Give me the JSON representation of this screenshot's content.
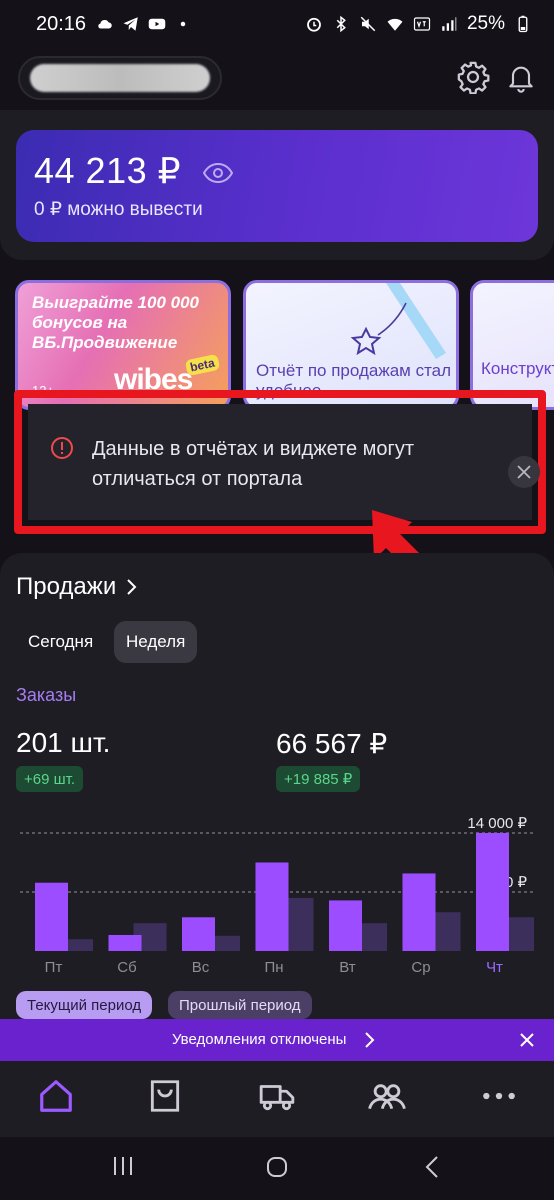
{
  "status_bar": {
    "time": "20:16",
    "battery": "25%",
    "icons_left": [
      "cloud-icon",
      "telegram-icon",
      "youtube-icon",
      "dot-icon"
    ],
    "icons_right": [
      "alarm-icon",
      "bluetooth-icon",
      "mute-icon",
      "wifi-icon",
      "volte-icon",
      "signal-icon",
      "battery-icon"
    ]
  },
  "top_bar": {
    "icons": [
      "gear-icon",
      "bell-icon"
    ]
  },
  "balance": {
    "amount": "44 213 ₽",
    "withdrawable": "0 ₽ можно вывести"
  },
  "promos": {
    "card1": {
      "title": "Выиграйте 100 000 бонусов на ВБ.Продвижение",
      "age": "12+",
      "logo": "wibes",
      "badge": "beta"
    },
    "card2": {
      "title": "Отчёт по продажам стал удобнее"
    },
    "card3": {
      "title": "Конструктор тарифов"
    }
  },
  "notice": {
    "text": "Данные в отчётах и виджете могут отличаться от портала"
  },
  "sales": {
    "title": "Продажи",
    "tabs": {
      "today": "Сегодня",
      "week": "Неделя"
    },
    "section": "Заказы",
    "count": "201 шт.",
    "count_delta": "+69 шт.",
    "sum": "66 567 ₽",
    "sum_delta": "+19 885 ₽",
    "legend": {
      "current": "Текущий период",
      "previous": "Прошлый период"
    }
  },
  "chart_data": {
    "type": "bar",
    "categories": [
      "Пт",
      "Сб",
      "Вс",
      "Пн",
      "Вт",
      "Ср",
      "Чт"
    ],
    "ylim": [
      0,
      14000
    ],
    "ticks": [
      "7 000 ₽",
      "14 000 ₽"
    ],
    "tick_values": [
      7000,
      14000
    ],
    "series": [
      {
        "name": "Текущий период",
        "values": [
          8100,
          1900,
          4000,
          10500,
          6000,
          9200,
          14000
        ]
      },
      {
        "name": "Прошлый период",
        "values": [
          1400,
          3300,
          1800,
          6300,
          3300,
          4600,
          4000
        ]
      }
    ],
    "colors": {
      "current": "#9b4dff",
      "previous": "#3d2f5c",
      "highlight_label": "#9b6bff"
    },
    "highlight_category": "Чт"
  },
  "notification_bar": {
    "text": "Уведомления отключены"
  },
  "tab_bar": {
    "items": [
      "home-icon",
      "bag-icon",
      "truck-icon",
      "users-icon",
      "more-icon"
    ],
    "active": "home-icon"
  },
  "colors": {
    "accent": "#8a4dff",
    "alert": "#e8161f",
    "background": "#141218"
  }
}
